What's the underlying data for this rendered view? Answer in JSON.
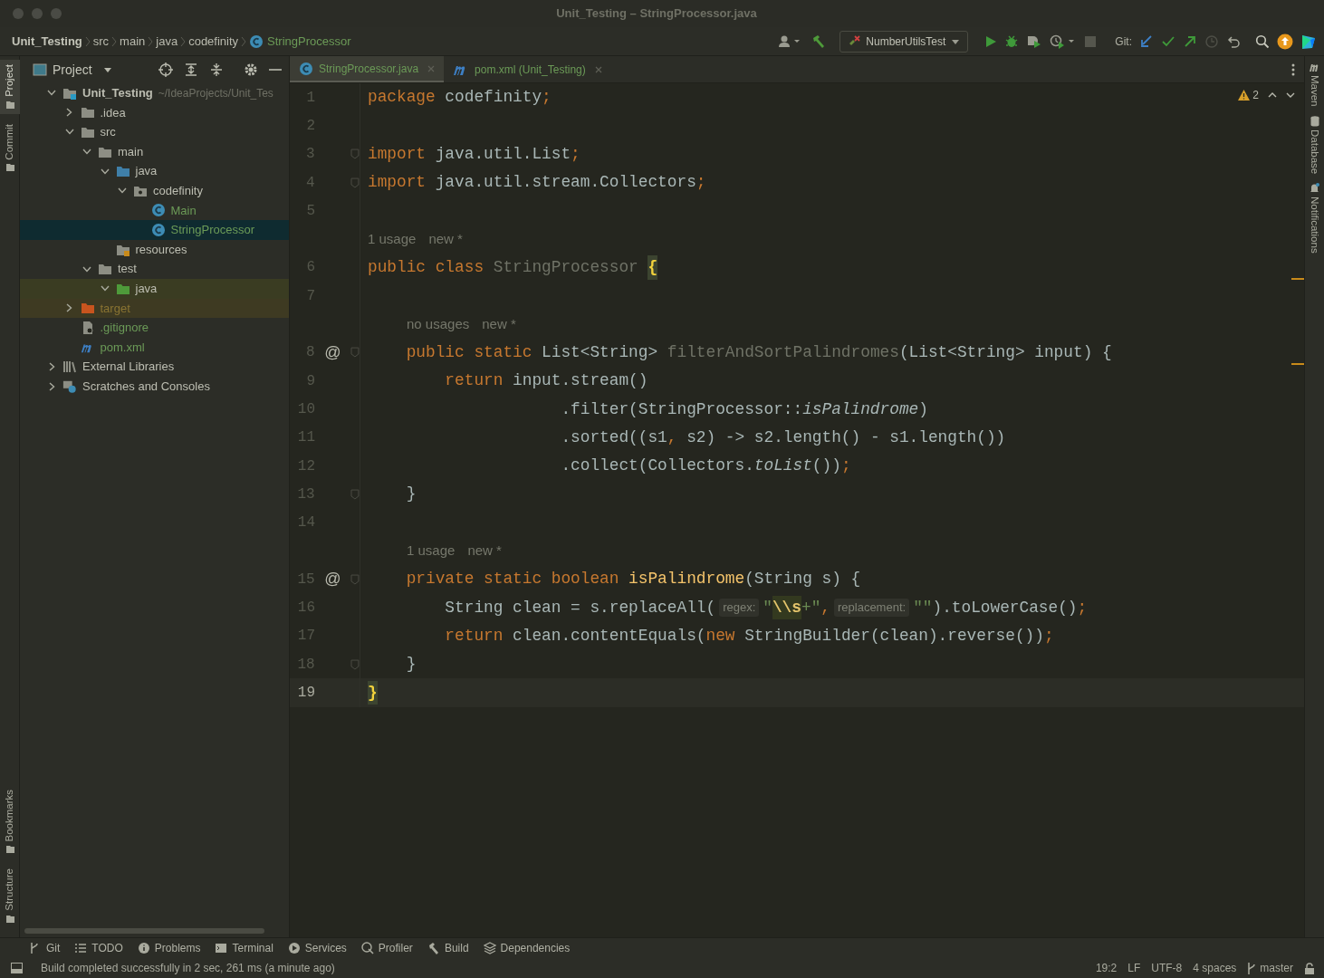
{
  "window": {
    "title": "Unit_Testing – StringProcessor.java"
  },
  "breadcrumbs": [
    {
      "label": "Unit_Testing",
      "kind": "project"
    },
    {
      "label": "src",
      "kind": "folder"
    },
    {
      "label": "main",
      "kind": "folder"
    },
    {
      "label": "java",
      "kind": "folder"
    },
    {
      "label": "codefinity",
      "kind": "folder"
    },
    {
      "label": "StringProcessor",
      "kind": "class"
    }
  ],
  "toolbar": {
    "run_config": "NumberUtilsTest",
    "git_label": "Git:"
  },
  "left_stripe": {
    "top": [
      {
        "label": "Project",
        "selected": true
      },
      {
        "label": "Commit",
        "selected": false
      }
    ],
    "bottom": [
      {
        "label": "Bookmarks",
        "selected": false
      },
      {
        "label": "Structure",
        "selected": false
      }
    ]
  },
  "right_stripe": [
    {
      "label": "Maven",
      "kind": "maven"
    },
    {
      "label": "Database",
      "kind": "database"
    },
    {
      "label": "Notifications",
      "kind": "bell"
    }
  ],
  "project_panel": {
    "title": "Project"
  },
  "tree": [
    {
      "label": "Unit_Testing",
      "path": "~/IdeaProjects/Unit_Tes",
      "kind": "module",
      "expanded": true,
      "selected": false,
      "children": [
        {
          "label": ".idea",
          "kind": "folder",
          "expanded": false,
          "selected": false
        },
        {
          "label": "src",
          "kind": "folder",
          "expanded": true,
          "selected": false,
          "children": [
            {
              "label": "main",
              "kind": "folder",
              "expanded": true,
              "selected": false,
              "children": [
                {
                  "label": "java",
                  "kind": "source",
                  "expanded": true,
                  "selected": false,
                  "children": [
                    {
                      "label": "codefinity",
                      "kind": "package",
                      "expanded": true,
                      "selected": false,
                      "children": [
                        {
                          "label": "Main",
                          "kind": "class",
                          "color": "#6b9a57",
                          "selected": false
                        },
                        {
                          "label": "StringProcessor",
                          "kind": "class",
                          "color": "#6b9a57",
                          "selected": true
                        }
                      ]
                    }
                  ]
                },
                {
                  "label": "resources",
                  "kind": "resources",
                  "selected": false
                }
              ]
            },
            {
              "label": "test",
              "kind": "folder",
              "expanded": true,
              "selected": false,
              "children": [
                {
                  "label": "java",
                  "kind": "test",
                  "selected": false,
                  "expanded": true
                }
              ]
            }
          ]
        },
        {
          "label": "target",
          "kind": "excluded",
          "color": "#8a7432",
          "expanded": false,
          "selected": false
        },
        {
          "label": ".gitignore",
          "kind": "gitignore",
          "color": "#6b9a57",
          "selected": false
        },
        {
          "label": "pom.xml",
          "kind": "maven",
          "color": "#6b9a57",
          "selected": false
        }
      ]
    },
    {
      "label": "External Libraries",
      "kind": "libraries",
      "expanded": false,
      "selected": false
    },
    {
      "label": "Scratches and Consoles",
      "kind": "scratches",
      "expanded": false,
      "selected": false
    }
  ],
  "tabs": [
    {
      "label": "StringProcessor.java",
      "kind": "class",
      "color": "#6b9a57",
      "selected": true
    },
    {
      "label": "pom.xml (Unit_Testing)",
      "kind": "maven",
      "color": "#6b9a57",
      "selected": false
    }
  ],
  "inspection": {
    "warnings": "2"
  },
  "code": [
    {
      "kind": "line",
      "number": "1",
      "current": false,
      "tokens": [
        {
          "kind": "kw",
          "text": "package"
        },
        {
          "kind": "pl",
          "text": " codefinity"
        },
        {
          "kind": "kw",
          "text": ";"
        }
      ]
    },
    {
      "kind": "line",
      "number": "2",
      "current": false
    },
    {
      "kind": "line",
      "number": "3",
      "current": false,
      "fold": true,
      "tokens": [
        {
          "kind": "kw",
          "text": "import"
        },
        {
          "kind": "pl",
          "text": " java.util.List"
        },
        {
          "kind": "kw",
          "text": ";"
        }
      ]
    },
    {
      "kind": "line",
      "number": "4",
      "current": false,
      "fold": true,
      "tokens": [
        {
          "kind": "kw",
          "text": "import"
        },
        {
          "kind": "pl",
          "text": " java.util.stream.Collectors"
        },
        {
          "kind": "kw",
          "text": ";"
        }
      ]
    },
    {
      "kind": "line",
      "number": "5",
      "current": false
    },
    {
      "kind": "lens",
      "indented": false,
      "texts": [
        "1 usage",
        "new *"
      ]
    },
    {
      "kind": "line",
      "number": "6",
      "current": false,
      "tokens": [
        {
          "kind": "kw",
          "text": "public class "
        },
        {
          "kind": "unused",
          "text": "StringProcessor "
        },
        {
          "kind": "brace",
          "text": "{"
        }
      ]
    },
    {
      "kind": "line",
      "number": "7",
      "current": false
    },
    {
      "kind": "lens",
      "indented": true,
      "texts": [
        "no usages",
        "new *"
      ]
    },
    {
      "kind": "line",
      "number": "8",
      "current": false,
      "mark": "@",
      "fold": true,
      "tokens": [
        {
          "kind": "kw",
          "text": "    public static "
        },
        {
          "kind": "pl",
          "text": "List<String> "
        },
        {
          "kind": "unused",
          "text": "filterAndSortPalindromes"
        },
        {
          "kind": "pl",
          "text": "(List<String> input) {"
        }
      ]
    },
    {
      "kind": "line",
      "number": "9",
      "current": false,
      "tokens": [
        {
          "kind": "kw",
          "text": "        return"
        },
        {
          "kind": "pl",
          "text": " input.stream()"
        }
      ]
    },
    {
      "kind": "line",
      "number": "10",
      "current": false,
      "tokens": [
        {
          "kind": "pl",
          "text": "                    .filter(StringProcessor::"
        },
        {
          "kind": "italic",
          "text": "isPalindrome"
        },
        {
          "kind": "pl",
          "text": ")"
        }
      ]
    },
    {
      "kind": "line",
      "number": "11",
      "current": false,
      "tokens": [
        {
          "kind": "pl",
          "text": "                    .sorted((s1"
        },
        {
          "kind": "kw",
          "text": ","
        },
        {
          "kind": "pl",
          "text": " s2) -> s2.length() - s1.length())"
        }
      ]
    },
    {
      "kind": "line",
      "number": "12",
      "current": false,
      "tokens": [
        {
          "kind": "pl",
          "text": "                    .collect(Collectors."
        },
        {
          "kind": "italic",
          "text": "toList"
        },
        {
          "kind": "pl",
          "text": "())"
        },
        {
          "kind": "kw",
          "text": ";"
        }
      ]
    },
    {
      "kind": "line",
      "number": "13",
      "current": false,
      "fold": true,
      "tokens": [
        {
          "kind": "pl",
          "text": "    }"
        }
      ]
    },
    {
      "kind": "line",
      "number": "14",
      "current": false
    },
    {
      "kind": "lens",
      "indented": true,
      "texts": [
        "1 usage",
        "new *"
      ]
    },
    {
      "kind": "line",
      "number": "15",
      "current": false,
      "mark": "@",
      "fold": true,
      "tokens": [
        {
          "kind": "kw",
          "text": "    private static boolean "
        },
        {
          "kind": "method",
          "text": "isPalindrome"
        },
        {
          "kind": "pl",
          "text": "(String s) {"
        }
      ]
    },
    {
      "kind": "line",
      "number": "16",
      "current": false,
      "tokens": [
        {
          "kind": "pl",
          "text": "        String clean = s.replaceAll("
        },
        {
          "kind": "hint",
          "text": "regex:"
        },
        {
          "kind": "str",
          "text": "\""
        },
        {
          "kind": "esc",
          "text": "\\\\s"
        },
        {
          "kind": "str",
          "text": "+\""
        },
        {
          "kind": "kw",
          "text": ","
        },
        {
          "kind": "hint",
          "text": "replacement:"
        },
        {
          "kind": "str",
          "text": "\"\""
        },
        {
          "kind": "pl",
          "text": ").toLowerCase()"
        },
        {
          "kind": "kw",
          "text": ";"
        }
      ]
    },
    {
      "kind": "line",
      "number": "17",
      "current": false,
      "tokens": [
        {
          "kind": "kw",
          "text": "        return"
        },
        {
          "kind": "pl",
          "text": " clean.contentEquals("
        },
        {
          "kind": "kw",
          "text": "new"
        },
        {
          "kind": "pl",
          "text": " StringBuilder(clean).reverse())"
        },
        {
          "kind": "kw",
          "text": ";"
        }
      ]
    },
    {
      "kind": "line",
      "number": "18",
      "current": false,
      "fold": true,
      "tokens": [
        {
          "kind": "pl",
          "text": "    }"
        }
      ]
    },
    {
      "kind": "line",
      "number": "19",
      "current": true,
      "tokens": [
        {
          "kind": "brace",
          "text": "}"
        }
      ]
    }
  ],
  "tool_tabs": [
    {
      "label": "Git",
      "kind": "git"
    },
    {
      "label": "TODO",
      "kind": "list"
    },
    {
      "label": "Problems",
      "kind": "info"
    },
    {
      "label": "Terminal",
      "kind": "terminal"
    },
    {
      "label": "Services",
      "kind": "services"
    },
    {
      "label": "Profiler",
      "kind": "profiler"
    },
    {
      "label": "Build",
      "kind": "hammer"
    },
    {
      "label": "Dependencies",
      "kind": "stack"
    }
  ],
  "status_bar": {
    "message": "Build completed successfully in 2 sec, 261 ms (a minute ago)",
    "position": "19:2",
    "line_separator": "LF",
    "encoding": "UTF-8",
    "indent": "4 spaces",
    "branch": "master"
  }
}
